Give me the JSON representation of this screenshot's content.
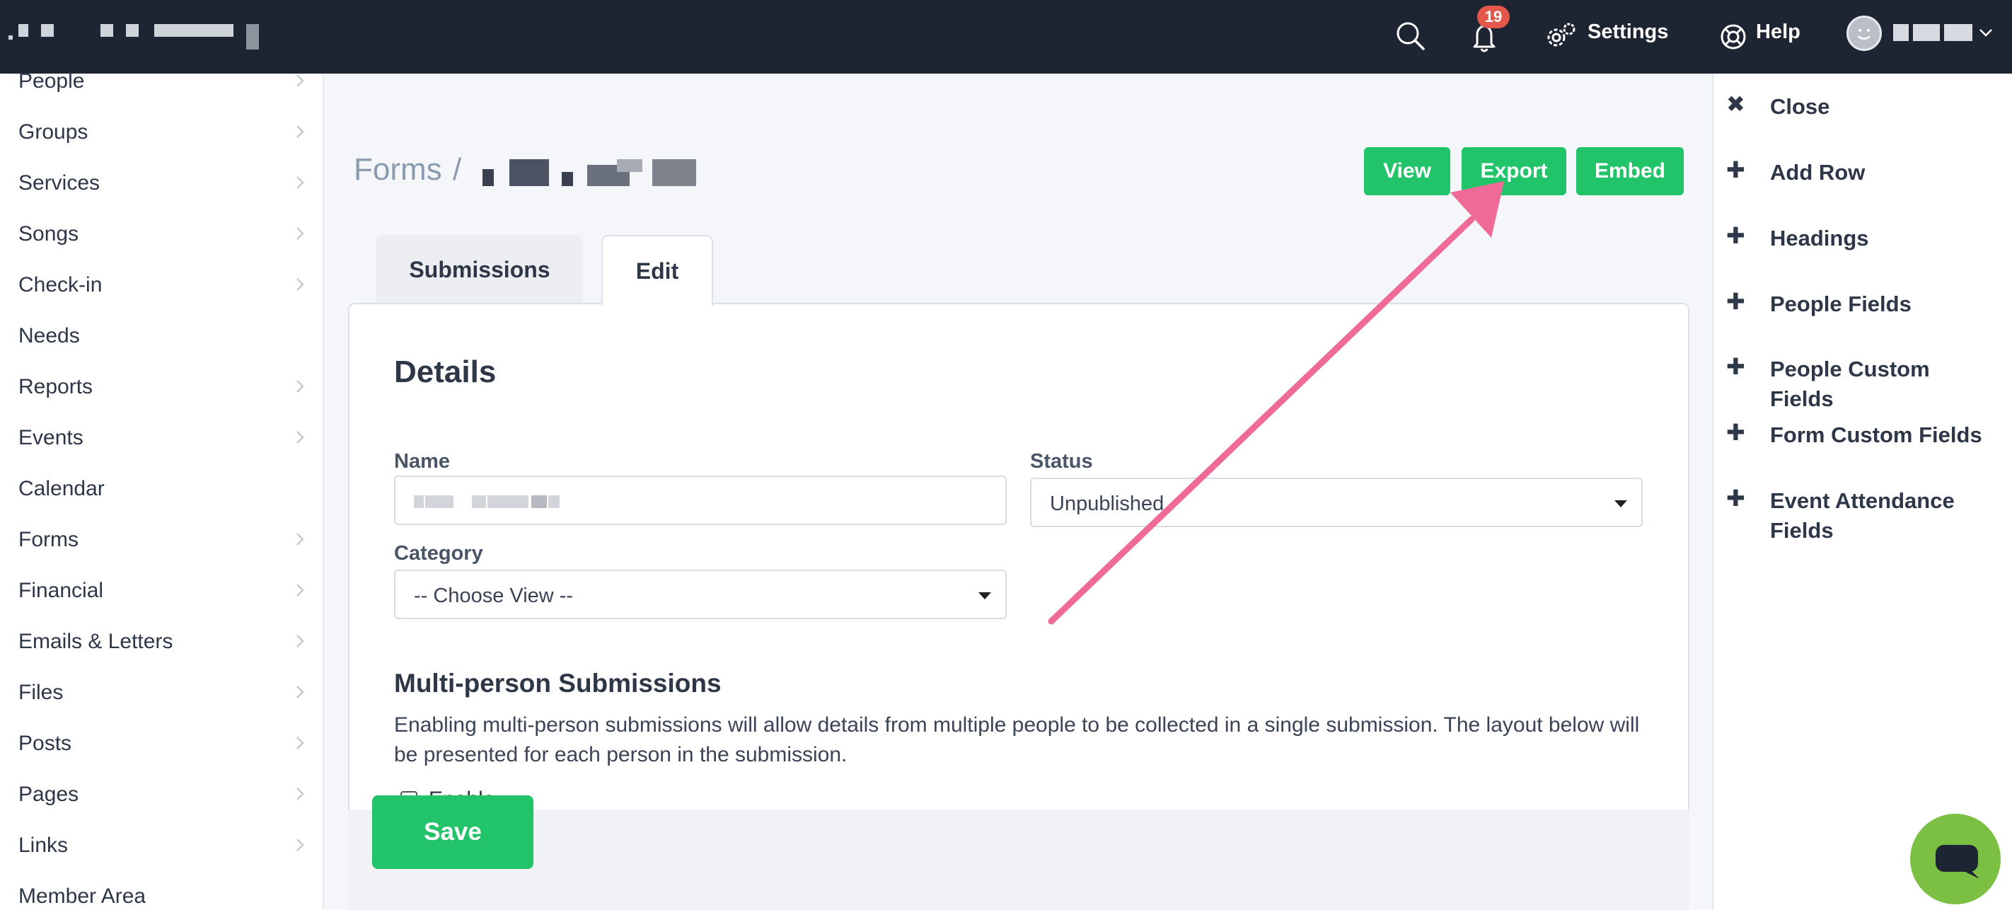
{
  "topbar": {
    "settings_label": "Settings",
    "help_label": "Help",
    "notification_count": "19",
    "icons": {
      "search": "search-icon",
      "bell": "bell-icon",
      "settings": "gears-icon",
      "help": "lifebuoy-icon",
      "avatar": "avatar-icon",
      "chevron": "chevron-down-icon"
    }
  },
  "sidebar": {
    "items": [
      {
        "label": "People",
        "chevron": true
      },
      {
        "label": "Groups",
        "chevron": true
      },
      {
        "label": "Services",
        "chevron": true
      },
      {
        "label": "Songs",
        "chevron": true
      },
      {
        "label": "Check-in",
        "chevron": true
      },
      {
        "label": "Needs",
        "chevron": false
      },
      {
        "label": "Reports",
        "chevron": true
      },
      {
        "label": "Events",
        "chevron": true
      },
      {
        "label": "Calendar",
        "chevron": false
      },
      {
        "label": "Forms",
        "chevron": true
      },
      {
        "label": "Financial",
        "chevron": true
      },
      {
        "label": "Emails & Letters",
        "chevron": true
      },
      {
        "label": "Files",
        "chevron": true
      },
      {
        "label": "Posts",
        "chevron": true
      },
      {
        "label": "Pages",
        "chevron": true
      },
      {
        "label": "Links",
        "chevron": true
      },
      {
        "label": "Member Area",
        "chevron": false
      }
    ]
  },
  "main": {
    "breadcrumb_root": "Forms",
    "breadcrumb_sep": "/",
    "buttons": {
      "view": "View",
      "export": "Export",
      "embed": "Embed"
    },
    "tabs": [
      {
        "label": "Submissions",
        "active": false
      },
      {
        "label": "Edit",
        "active": true
      }
    ],
    "details_heading": "Details",
    "name_label": "Name",
    "status_label": "Status",
    "status_value": "Unpublished",
    "category_label": "Category",
    "category_value": "-- Choose View --",
    "multi_heading": "Multi-person Submissions",
    "multi_desc": "Enabling multi-person submissions will allow details from multiple people to be collected in a single submission. The layout below will be presented for each person in the submission.",
    "enable_label": "Enable",
    "save_label": "Save"
  },
  "panel": {
    "items": [
      {
        "icon": "close-icon",
        "glyph": "✖",
        "label": "Close"
      },
      {
        "icon": "plus-icon",
        "glyph": "✚",
        "label": "Add Row"
      },
      {
        "icon": "plus-icon",
        "glyph": "✚",
        "label": "Headings"
      },
      {
        "icon": "plus-icon",
        "glyph": "✚",
        "label": "People Fields"
      },
      {
        "icon": "plus-icon",
        "glyph": "✚",
        "label": "People Custom Fields"
      },
      {
        "icon": "plus-icon",
        "glyph": "✚",
        "label": "Form Custom Fields"
      },
      {
        "icon": "plus-icon",
        "glyph": "✚",
        "label": "Event Attendance Fields"
      }
    ]
  },
  "colors": {
    "topbar": "#1d2432",
    "accent_green": "#22c46a",
    "badge": "#e4574b",
    "annotation_arrow": "#ef6a96",
    "chat_button": "#7bc043"
  }
}
